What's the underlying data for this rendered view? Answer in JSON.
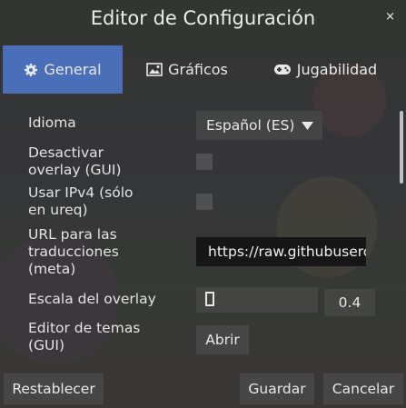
{
  "window": {
    "title": "Editor de Configuración",
    "close_glyph": "×"
  },
  "tabs": [
    {
      "label": "General",
      "icon": "gear-icon",
      "active": true
    },
    {
      "label": "Gráficos",
      "icon": "image-icon",
      "active": false
    },
    {
      "label": "Jugabilidad",
      "icon": "gamepad-icon",
      "active": false
    }
  ],
  "settings": {
    "language": {
      "label": "Idioma",
      "value": "Español (ES)"
    },
    "disable_overlay": {
      "label_line1": "Desactivar",
      "label_line2": "overlay (GUI)",
      "checked": false
    },
    "use_ipv4": {
      "label_line1": "Usar IPv4 (sólo",
      "label_line2": "en ureq)",
      "checked": false
    },
    "translations_url": {
      "label_line1": "URL para las",
      "label_line2": "traducciones",
      "label_line3": "(meta)",
      "value": "https://raw.githubusercontent.com"
    },
    "overlay_scale": {
      "label": "Escala del overlay",
      "value": "0.4"
    },
    "theme_editor": {
      "label_line1": "Editor de temas",
      "label_line2": "(GUI)",
      "button": "Abrir"
    }
  },
  "footer": {
    "reset": "Restablecer",
    "save": "Guardar",
    "cancel": "Cancelar"
  }
}
